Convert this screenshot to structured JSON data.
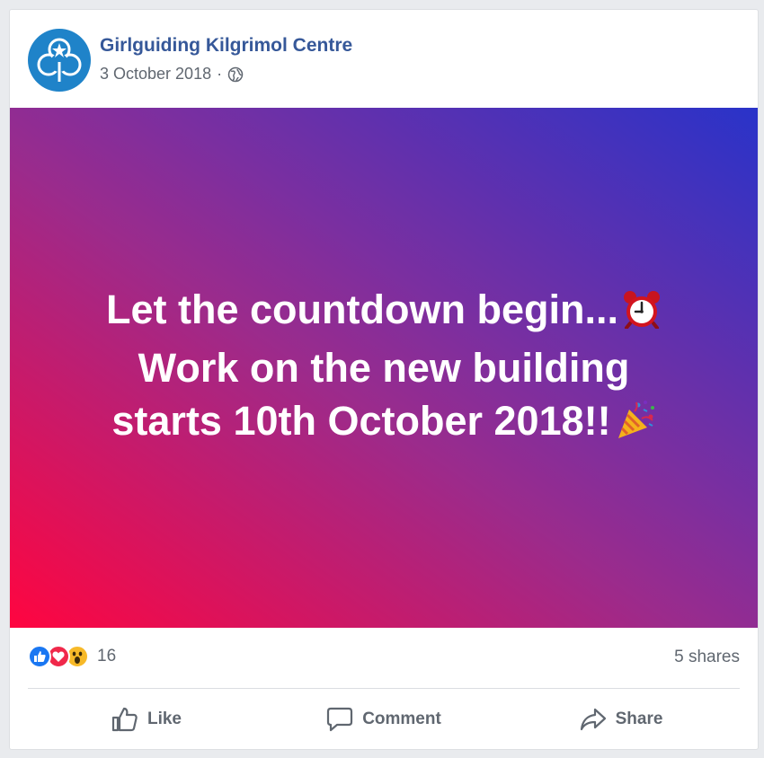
{
  "post": {
    "page_name": "Girlguiding Kilgrimol Centre",
    "date": "3 October 2018",
    "separator": "·",
    "privacy_icon": "globe-icon",
    "status_lines": [
      "Let the countdown begin...",
      "Work on the new building",
      "starts 10th October 2018!!"
    ],
    "status_emojis": [
      "alarm-clock-emoji",
      "party-popper-emoji"
    ],
    "gradient_colors": [
      "#ff0540",
      "#9b2b8c",
      "#2933c9"
    ]
  },
  "reactions": {
    "icons": [
      "like-reaction-icon",
      "love-reaction-icon",
      "wow-reaction-icon"
    ],
    "count": "16",
    "shares": "5 shares"
  },
  "actions": {
    "like": "Like",
    "comment": "Comment",
    "share": "Share"
  },
  "colors": {
    "page_name": "#365899",
    "meta": "#606770",
    "like_blue": "#1a77f2",
    "love_red": "#f0284a",
    "wow_yellow": "#f7b928"
  }
}
